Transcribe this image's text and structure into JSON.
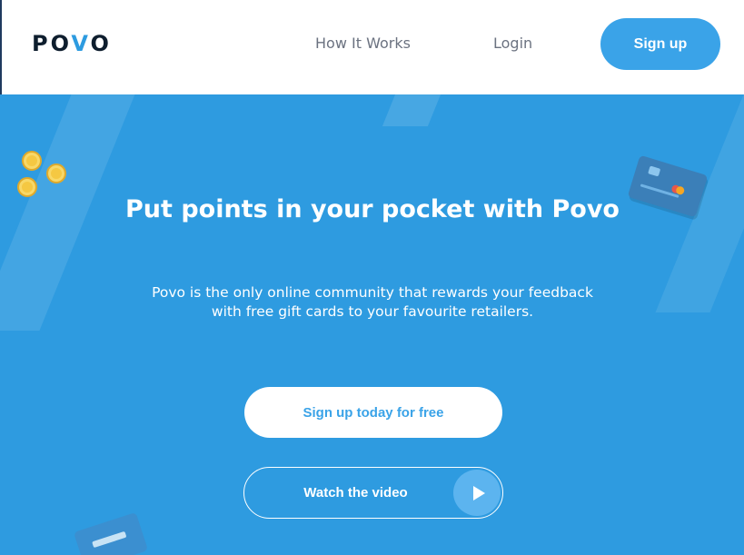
{
  "header": {
    "logo_prefix": "PO",
    "logo_v": "V",
    "logo_suffix": "O",
    "nav": [
      {
        "label": "How It Works"
      },
      {
        "label": "Login"
      }
    ],
    "signup_label": "Sign up"
  },
  "hero": {
    "title": "Put points in your pocket with Povo",
    "description": "Povo is the only online community that rewards your feedback with free gift cards to your favourite retailers.",
    "primary_cta": "Sign up today for free",
    "video_cta": "Watch the video"
  },
  "colors": {
    "brand_blue": "#2e9be0",
    "button_blue": "#3aa3e8",
    "logo_dark": "#0e1e2e",
    "coin_gold": "#f5c842"
  },
  "icons": [
    "coin-icon",
    "credit-card-icon",
    "play-icon"
  ]
}
